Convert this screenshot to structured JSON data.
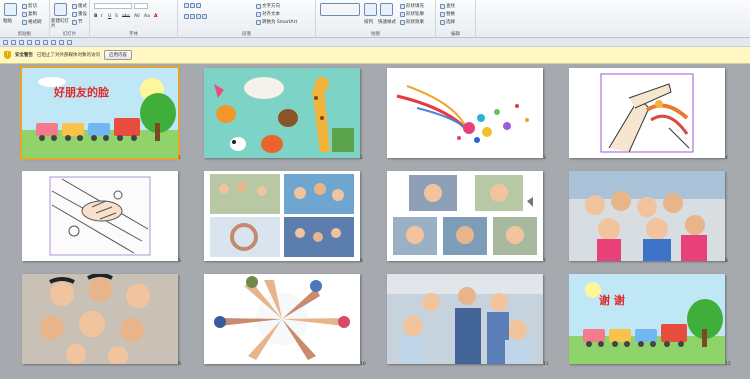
{
  "ribbon": {
    "groups": [
      {
        "label": "剪贴板",
        "tools": [
          "粘贴",
          "剪切",
          "复制",
          "格式刷"
        ]
      },
      {
        "label": "幻灯片",
        "tools": [
          "新建幻灯片",
          "版式",
          "重设",
          "节"
        ]
      },
      {
        "label": "字体",
        "tools": [
          "B",
          "I",
          "U",
          "S",
          "abc",
          "AV",
          "Aa",
          "A"
        ]
      },
      {
        "label": "段落",
        "tools": [
          "文字方向",
          "对齐文本",
          "转换为 SmartArt"
        ]
      },
      {
        "label": "绘图",
        "tools": [
          "排列",
          "快速样式",
          "形状填充",
          "形状轮廓",
          "形状效果"
        ]
      },
      {
        "label": "编辑",
        "tools": [
          "查找",
          "替换",
          "选择"
        ]
      }
    ]
  },
  "security_bar": {
    "title": "安全警告",
    "message": "已阻止了对外部媒体对象的访问",
    "button": "启用内容"
  },
  "slides": [
    {
      "num": "1",
      "title": "好朋友的脸",
      "selected": true
    },
    {
      "num": "2",
      "title": "",
      "selected": false
    },
    {
      "num": "3",
      "title": "",
      "selected": false
    },
    {
      "num": "4",
      "title": "",
      "selected": false
    },
    {
      "num": "5",
      "title": "",
      "selected": false
    },
    {
      "num": "6",
      "title": "",
      "selected": false
    },
    {
      "num": "7",
      "title": "",
      "selected": false
    },
    {
      "num": "8",
      "title": "",
      "selected": false
    },
    {
      "num": "9",
      "title": "",
      "selected": false
    },
    {
      "num": "10",
      "title": "",
      "selected": false
    },
    {
      "num": "11",
      "title": "",
      "selected": false
    },
    {
      "num": "12",
      "title": "谢 谢",
      "selected": false
    }
  ],
  "colors": {
    "selection": "#e3a52c",
    "title_red": "#e02a2a",
    "background": "#a6a9ae"
  }
}
